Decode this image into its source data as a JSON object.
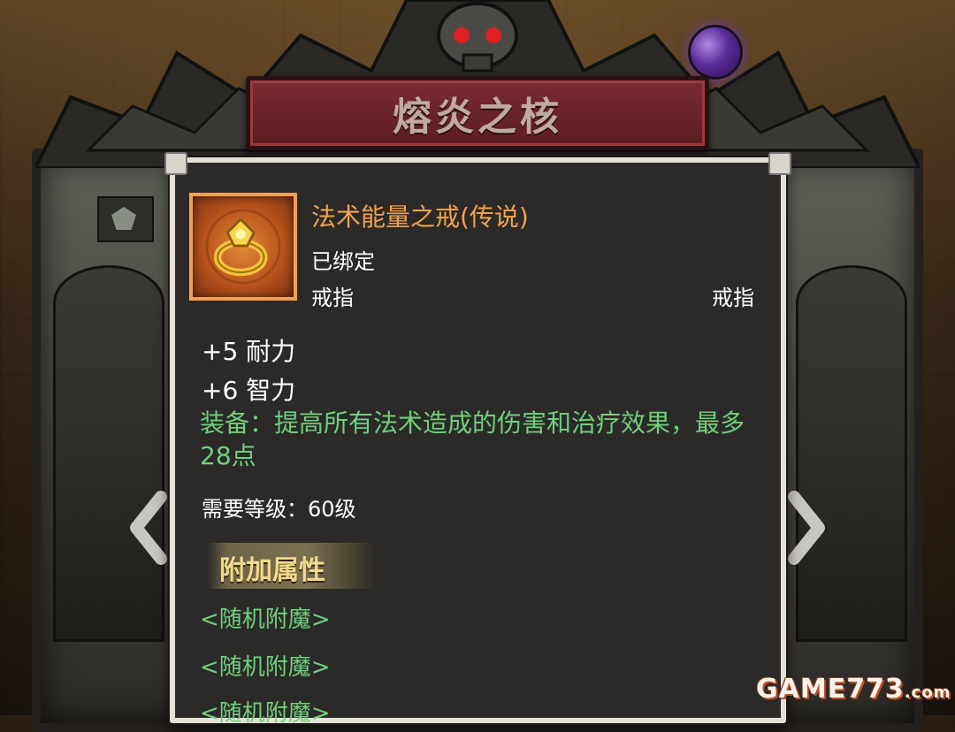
{
  "header": {
    "title": "熔炎之核"
  },
  "item": {
    "name": "法术能量之戒(传说)",
    "bound": "已绑定",
    "slot": "戒指",
    "type": "戒指",
    "icon": "gold-ring-icon",
    "name_color": "#f1a24e"
  },
  "stats": [
    {
      "text": "+5 耐力"
    },
    {
      "text": "+6 智力"
    }
  ],
  "equip_effect": "装备：提高所有法术造成的伤害和治疗效果，最多28点",
  "requirement": "需要等级：60级",
  "extra": {
    "title": "附加属性",
    "enchants": [
      "<随机附魔>",
      "<随机附魔>",
      "<随机附魔>"
    ]
  },
  "colors": {
    "green_text": "#6fd07a",
    "title_plate": "#7a2b30",
    "panel_bg": "#2b2a28"
  },
  "watermark": {
    "text": "GAME773",
    "domain": ".com"
  }
}
